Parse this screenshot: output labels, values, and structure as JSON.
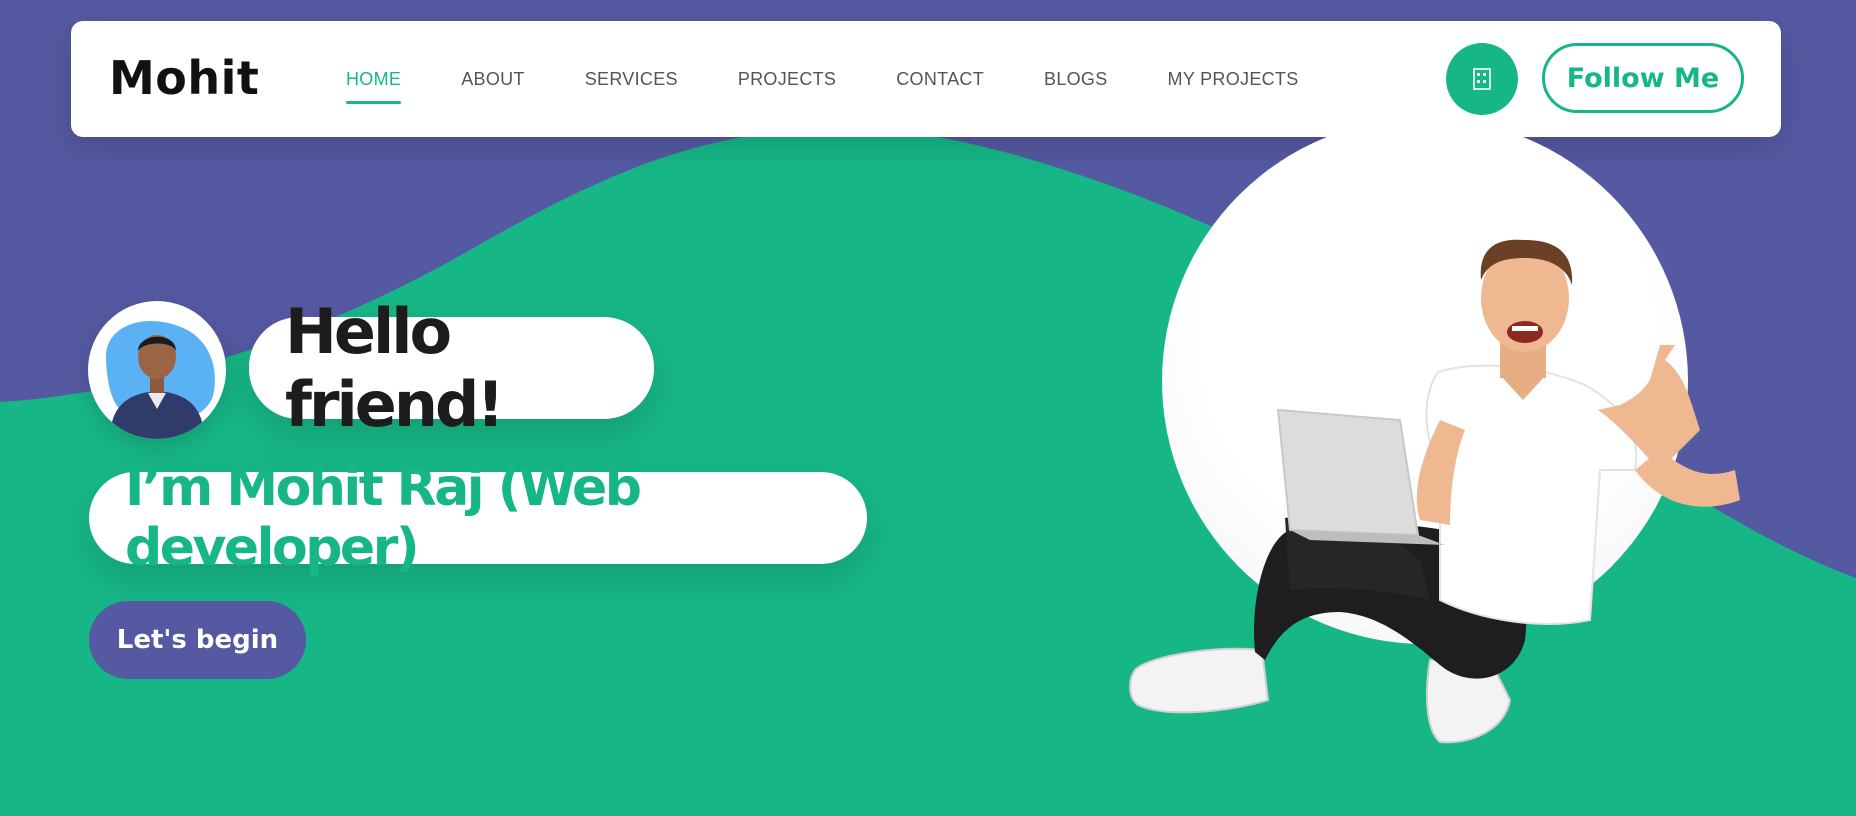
{
  "brand": {
    "name": "Mohit"
  },
  "nav": {
    "items": [
      {
        "label": "HOME",
        "active": true
      },
      {
        "label": "ABOUT",
        "active": false
      },
      {
        "label": "SERVICES",
        "active": false
      },
      {
        "label": "PROJECTS",
        "active": false
      },
      {
        "label": "CONTACT",
        "active": false
      },
      {
        "label": "BLOGS",
        "active": false
      },
      {
        "label": "MY PROJECTS",
        "active": false
      }
    ],
    "icon_button": {
      "icon": "qr-code-icon"
    },
    "follow_label": "Follow Me"
  },
  "hero": {
    "greeting": "Hello friend!",
    "intro": "I’m Mohit Raj (Web developer)",
    "cta_label": "Let's begin"
  },
  "colors": {
    "primary": "#17b686",
    "secondary": "#5459a1",
    "text_dark": "#1c1c1c",
    "nav_text": "#555555"
  }
}
